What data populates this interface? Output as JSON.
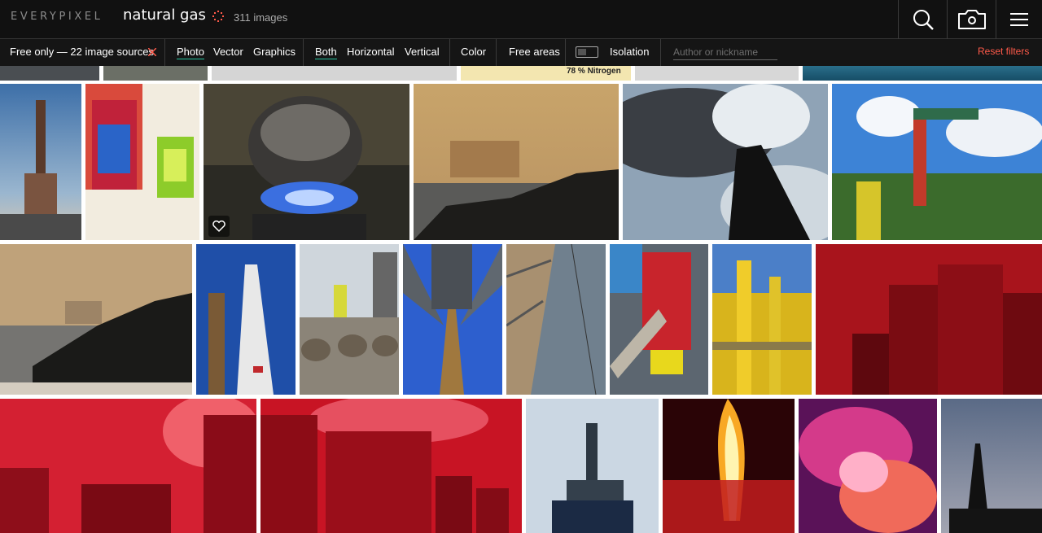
{
  "header": {
    "logo": "EVERYPIXEL",
    "query": "natural gas",
    "count": "311 images",
    "icons": [
      "search-icon",
      "camera-icon",
      "menu-icon"
    ]
  },
  "filters": {
    "sources": "Free only — 22 image sources",
    "types": [
      "Photo",
      "Vector",
      "Graphics"
    ],
    "orientations": [
      "Both",
      "Horizontal",
      "Vertical"
    ],
    "color": "Color",
    "free_areas": "Free areas",
    "isolation": "Isolation",
    "author_placeholder": "Author or nickname",
    "reset": "Reset filters",
    "active_accent": "#27c5a0",
    "reset_color": "#ff5a4a"
  },
  "banner": {
    "nitrogen_label": "78 % Nitrogen"
  },
  "tiles": [
    "drilling-rig-sunset",
    "red-and-green-lanterns",
    "kettle-on-gas-flame",
    "ship-on-hazy-horizon",
    "rig-silhouette-clouds",
    "oil-pump-jack",
    "ship-behind-rocks",
    "derrick-blue-sky",
    "pipes-on-platform",
    "looking-up-derrick",
    "derrick-steel-frame",
    "red-wellhead-valve",
    "yellow-pipework",
    "red-storage-tanks",
    "red-tanks-with-stairs",
    "red-silos",
    "offshore-platform",
    "gas-flare",
    "pink-smoke-swirl",
    "rig-at-dusk"
  ]
}
